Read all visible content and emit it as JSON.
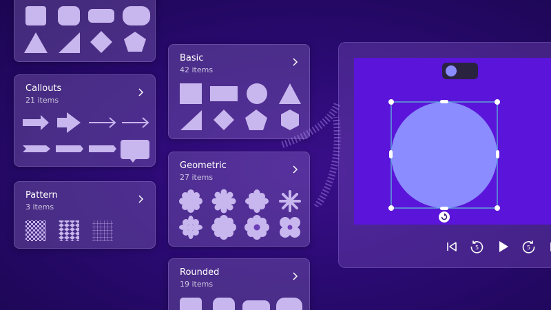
{
  "cards": {
    "callouts": {
      "title": "Callouts",
      "count": "21 items"
    },
    "pattern": {
      "title": "Pattern",
      "count": "3 items"
    },
    "basic": {
      "title": "Basic",
      "count": "42 items"
    },
    "geometric": {
      "title": "Geometric",
      "count": "27 items"
    },
    "rounded": {
      "title": "Rounded",
      "count": "19 items"
    }
  },
  "colors": {
    "background": "#2a0a72",
    "canvas": "#5b14d9",
    "shape_fill": "#8a8cff",
    "thumb_fill": "#c8b6ee",
    "selection": "#5ec8d8"
  },
  "icons": {
    "chevron": "chevron-right-icon",
    "rotate": "rotate-icon",
    "skip_back": "skip-back-icon",
    "rewind": "rewind-5-icon",
    "play": "play-icon",
    "forward": "forward-5-icon",
    "skip_forward": "skip-forward-icon"
  },
  "player": {
    "rewind_seconds": "5",
    "forward_seconds": "5"
  }
}
